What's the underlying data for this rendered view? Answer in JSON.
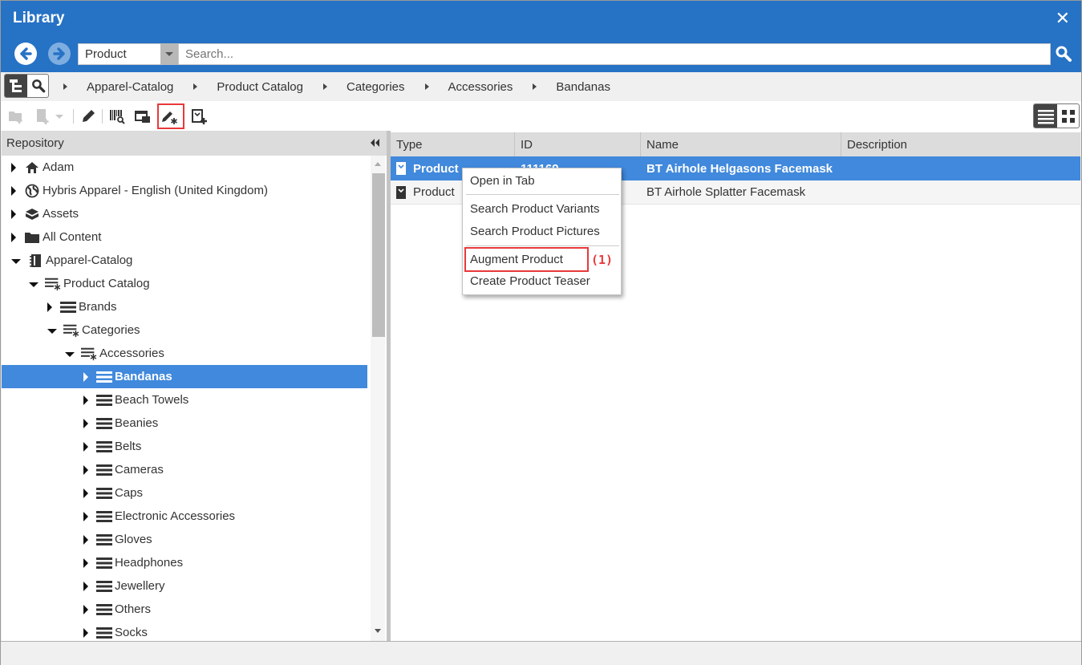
{
  "window": {
    "title": "Library",
    "close_icon": "close-icon"
  },
  "nav": {
    "back_icon": "arrow-left-circle-icon",
    "forward_icon": "arrow-right-circle-icon"
  },
  "search": {
    "type_value": "Product",
    "placeholder": "Search...",
    "value": "",
    "search_icon": "search-icon"
  },
  "breadcrumb": {
    "items": [
      "Apparel-Catalog",
      "Product Catalog",
      "Categories",
      "Accessories",
      "Bandanas"
    ]
  },
  "toolbar": {
    "buttons": [
      {
        "name": "new-folder",
        "icon": "folder-plus-icon",
        "enabled": false
      },
      {
        "name": "new-document",
        "icon": "document-plus-icon",
        "enabled": false
      },
      {
        "name": "edit",
        "icon": "pencil-icon",
        "enabled": true
      },
      {
        "name": "search-barcode",
        "icon": "barcode-search-icon",
        "enabled": true
      },
      {
        "name": "open-window",
        "icon": "window-icon",
        "enabled": true
      },
      {
        "name": "augment",
        "icon": "pencil-asterisk-icon",
        "enabled": true
      },
      {
        "name": "create-teaser",
        "icon": "product-plus-icon",
        "enabled": true
      }
    ],
    "annotation": "(1)"
  },
  "view_toggle": {
    "list_icon": "list-view-icon",
    "grid_icon": "grid-view-icon",
    "active": "list"
  },
  "repository": {
    "header": "Repository",
    "collapse_icon": "double-chevron-left-icon",
    "tree": [
      {
        "label": "Adam",
        "level": 0,
        "expanded": false,
        "icon": "home-icon"
      },
      {
        "label": "Hybris Apparel - English (United Kingdom)",
        "level": 0,
        "expanded": false,
        "icon": "globe-icon"
      },
      {
        "label": "Assets",
        "level": 0,
        "expanded": false,
        "icon": "box-icon"
      },
      {
        "label": "All Content",
        "level": 0,
        "expanded": false,
        "icon": "folder-icon"
      },
      {
        "label": "Apparel-Catalog",
        "level": 0,
        "expanded": true,
        "icon": "catalog-icon"
      },
      {
        "label": "Product Catalog",
        "level": 1,
        "expanded": true,
        "icon": "category-star-icon"
      },
      {
        "label": "Brands",
        "level": 2,
        "expanded": false,
        "icon": "list-icon"
      },
      {
        "label": "Categories",
        "level": 2,
        "expanded": true,
        "icon": "category-star-icon"
      },
      {
        "label": "Accessories",
        "level": 3,
        "expanded": true,
        "icon": "category-star-icon"
      },
      {
        "label": "Bandanas",
        "level": 4,
        "expanded": false,
        "icon": "list-icon",
        "selected": true
      },
      {
        "label": "Beach Towels",
        "level": 4,
        "expanded": false,
        "icon": "list-icon"
      },
      {
        "label": "Beanies",
        "level": 4,
        "expanded": false,
        "icon": "list-icon"
      },
      {
        "label": "Belts",
        "level": 4,
        "expanded": false,
        "icon": "list-icon"
      },
      {
        "label": "Cameras",
        "level": 4,
        "expanded": false,
        "icon": "list-icon"
      },
      {
        "label": "Caps",
        "level": 4,
        "expanded": false,
        "icon": "list-icon"
      },
      {
        "label": "Electronic Accessories",
        "level": 4,
        "expanded": false,
        "icon": "list-icon"
      },
      {
        "label": "Gloves",
        "level": 4,
        "expanded": false,
        "icon": "list-icon"
      },
      {
        "label": "Headphones",
        "level": 4,
        "expanded": false,
        "icon": "list-icon"
      },
      {
        "label": "Jewellery",
        "level": 4,
        "expanded": false,
        "icon": "list-icon"
      },
      {
        "label": "Others",
        "level": 4,
        "expanded": false,
        "icon": "list-icon"
      },
      {
        "label": "Socks",
        "level": 4,
        "expanded": false,
        "icon": "list-icon"
      }
    ]
  },
  "grid": {
    "columns": [
      "Type",
      "ID",
      "Name",
      "Description"
    ],
    "rows": [
      {
        "type": "Product",
        "id": "111169",
        "name": "BT Airhole Helgasons Facemask",
        "description": "",
        "selected": true
      },
      {
        "type": "Product",
        "id": "",
        "name": "BT Airhole Splatter Facemask",
        "description": "",
        "selected": false
      }
    ]
  },
  "context_menu": {
    "items": [
      "Open in Tab",
      "Search Product Variants",
      "Search Product Pictures",
      "Augment Product",
      "Create Product Teaser"
    ],
    "highlighted": "Augment Product",
    "annotation": "(1)"
  },
  "colors": {
    "accent": "#2672c5",
    "selection": "#4189dc",
    "annotation": "#e8393b"
  }
}
